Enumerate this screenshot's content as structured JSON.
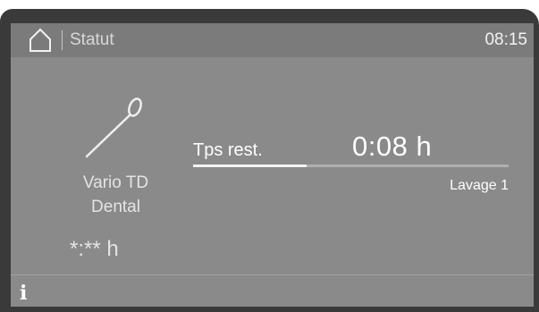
{
  "header": {
    "home_icon": "home-icon",
    "title": "Statut",
    "time": "08:15"
  },
  "program": {
    "icon": "dental-instrument-icon",
    "name_line1": "Vario TD",
    "name_line2": "Dental",
    "duration": "*:** h"
  },
  "remaining": {
    "label": "Tps rest.",
    "value": "0:08 h",
    "progress_fraction": 0.36,
    "phase": "Lavage 1"
  },
  "footer": {
    "info_icon": "info-icon",
    "info_glyph": "i"
  },
  "colors": {
    "screen_bg": "#8a8a8a",
    "bezel": "#3a3a3a",
    "text": "#ffffff"
  }
}
